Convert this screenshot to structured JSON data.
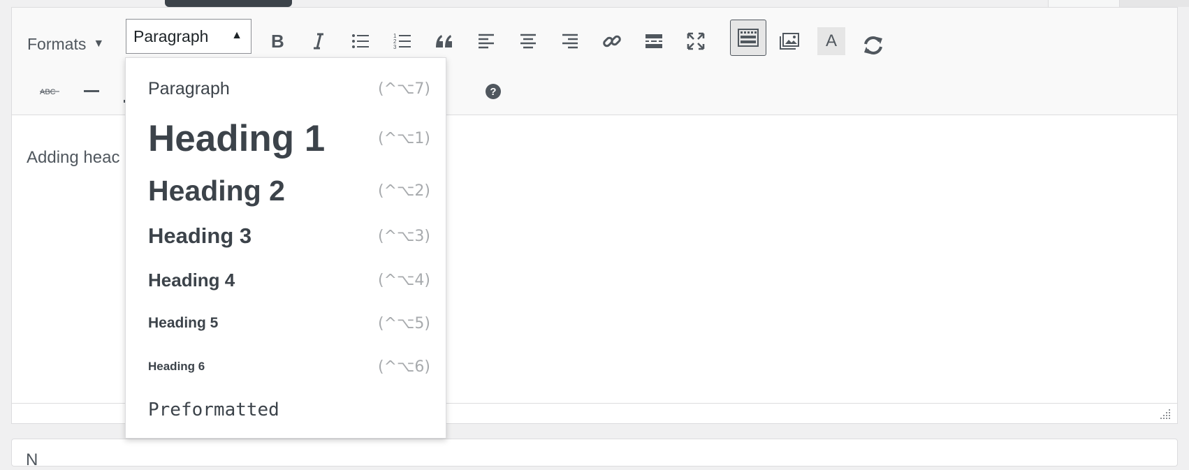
{
  "toolbar": {
    "formats_label": "Formats",
    "formats_caret": "▼",
    "block_select": {
      "value": "Paragraph",
      "caret": "▲"
    },
    "text_color_label": "A",
    "underline_label": "A",
    "strikethrough_label": "ABC"
  },
  "icons": [
    "bold-icon",
    "italic-icon",
    "bullet-list-icon",
    "numbered-list-icon",
    "blockquote-icon",
    "align-left-icon",
    "align-center-icon",
    "align-right-icon",
    "link-icon",
    "read-more-icon",
    "fullscreen-icon",
    "toolbar-toggle-icon",
    "add-media-icon",
    "text-color-icon",
    "refresh-icon",
    "strikethrough-icon",
    "horizontal-line-icon",
    "underline-icon",
    "help-icon",
    "resize-handle-icon"
  ],
  "editor": {
    "content_text": "Adding heac"
  },
  "lower_box": {
    "text": "N"
  },
  "dropdown": {
    "items": [
      {
        "label": "Paragraph",
        "shortcut": "(^⌥7)"
      },
      {
        "label": "Heading 1",
        "shortcut": "(^⌥1)"
      },
      {
        "label": "Heading 2",
        "shortcut": "(^⌥2)"
      },
      {
        "label": "Heading 3",
        "shortcut": "(^⌥3)"
      },
      {
        "label": "Heading 4",
        "shortcut": "(^⌥4)"
      },
      {
        "label": "Heading 5",
        "shortcut": "(^⌥5)"
      },
      {
        "label": "Heading 6",
        "shortcut": "(^⌥6)"
      },
      {
        "label": "Preformatted",
        "shortcut": ""
      }
    ]
  },
  "colors": {
    "toolbar_bg": "#f9f9f9",
    "border": "#dcdcde",
    "icon": "#50575e",
    "shortcut": "#a7aaad",
    "tooltip": "#3c434a"
  }
}
